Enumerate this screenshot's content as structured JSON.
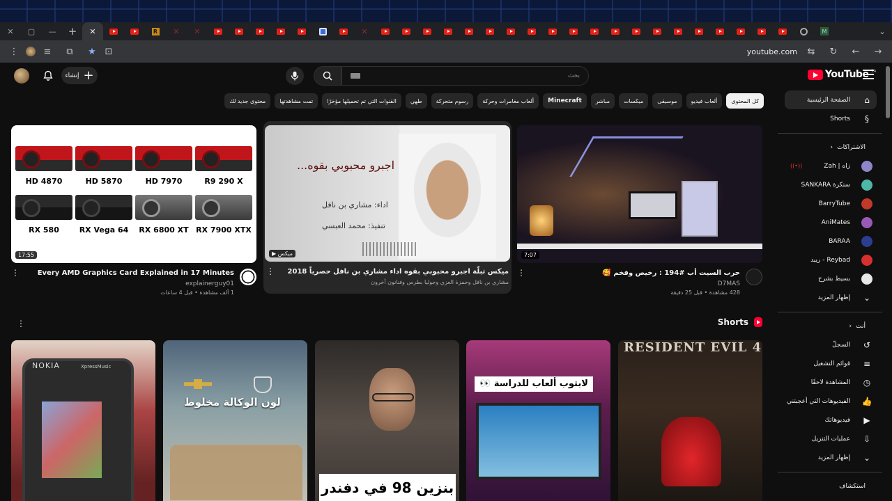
{
  "browser": {
    "window_controls": [
      "✕",
      "▢",
      "—"
    ],
    "new_tab": "+",
    "active_tab_close": "✕",
    "tab_favicons": [
      "yt",
      "yt",
      "r",
      "x",
      "x",
      "yt",
      "yt",
      "yt",
      "yt",
      "yt",
      "b",
      "yt",
      "x",
      "yt",
      "yt",
      "yt",
      "yt",
      "yt",
      "yt",
      "yt",
      "yt",
      "yt",
      "yt",
      "yt",
      "yt",
      "yt",
      "yt",
      "yt",
      "yt",
      "yt",
      "yt",
      "yt",
      "yt",
      "g",
      "m"
    ],
    "tab_r_letter": "R",
    "tab_m_letter": "M",
    "tab_dropdown": "⌄",
    "address": "youtube.com"
  },
  "masthead": {
    "create_label": "إنشاء",
    "search_placeholder": "بحث",
    "brand": "YouTube",
    "country": "SA"
  },
  "chips": [
    "كل المحتوى",
    "ألعاب فيديو",
    "موسيقى",
    "ميكسات",
    "مباشر",
    "Minecraft",
    "ألعاب مغامرات وحركة",
    "رسوم متحركة",
    "طهي",
    "القنوات التي تم تحميلها مؤخرًا",
    "تمت مشاهدتها",
    "محتوى جديد لك"
  ],
  "sidebar": {
    "home": "الصفحة الرئيسية",
    "shorts": "Shorts",
    "subs_heading": "الاشتراكات",
    "subscriptions": [
      {
        "name": "Zah | زاه",
        "color": "#8d86c9"
      },
      {
        "name": "SANKARA سنكرة",
        "color": "#4fb7a8"
      },
      {
        "name": "BarryTube",
        "color": "#c0392b"
      },
      {
        "name": "AniMates",
        "color": "#9b59b6"
      },
      {
        "name": "BARAA",
        "color": "#2c3e91"
      },
      {
        "name": "ريبد - Reybad",
        "color": "#d63031"
      },
      {
        "name": "بسيط بشرح",
        "color": "#e8e8e8"
      }
    ],
    "show_more": "إظهار المزيد",
    "you_heading": "أنت",
    "you_items": [
      "السجلّ",
      "قوائم التشغيل",
      "المشاهدة لاحقًا",
      "الفيديوهات التي أعجبتني",
      "فيديوهاتك",
      "عمليات التنزيل"
    ],
    "show_more_2": "إظهار المزيد",
    "explore": "استكشاف"
  },
  "videos": [
    {
      "title": "حرب السيت أب #194 : رخيص وفخم 🥰",
      "channel": "D7MAS",
      "stats": "428 مشاهدة • قبل 25 دقيقة",
      "duration": "7:07"
    },
    {
      "title": "ميكس تبلّة اجبرو محبوبي بقوه  اداء مشاري بن نافل   حصرياً 2018",
      "channel": "مشاري بن نافل وحمزة العزي وجوليا بطرس وفنانون آخرون",
      "badge": "ميكس",
      "thumb_title": "اجبرو محبوبي بقوه...",
      "thumb_line1": "اداء: مشاري بن نافل",
      "thumb_line2": "تنفيذ: محمد العبسي"
    },
    {
      "title": "Every AMD Graphics Card Explained in 17 Minutes",
      "channel": "explainerguy01",
      "stats": "1 ألف مشاهدة • قبل 4 ساعات",
      "duration": "17:55",
      "gpus": [
        "HD 4870",
        "HD 5870",
        "HD 7970",
        "R9 290 X",
        "RX 580",
        "RX Vega 64",
        "RX 6800 XT",
        "RX 7900 XTX"
      ]
    }
  ],
  "shorts": {
    "heading": "Shorts",
    "items": [
      {
        "nokia": "NOKIA",
        "xm": "XpressMusic"
      },
      {
        "caption": "لون الوكالة مخلوط"
      },
      {
        "caption": "بنزين 98 في دفندر"
      },
      {
        "caption": "لابتوب ألعاب للدراسة 👀"
      },
      {
        "caption": "RESIDENT EVIL 4"
      }
    ]
  },
  "colors": {
    "brand_red": "#ff0033",
    "page_bg": "#0f0f0f",
    "chip_bg": "#272727"
  }
}
